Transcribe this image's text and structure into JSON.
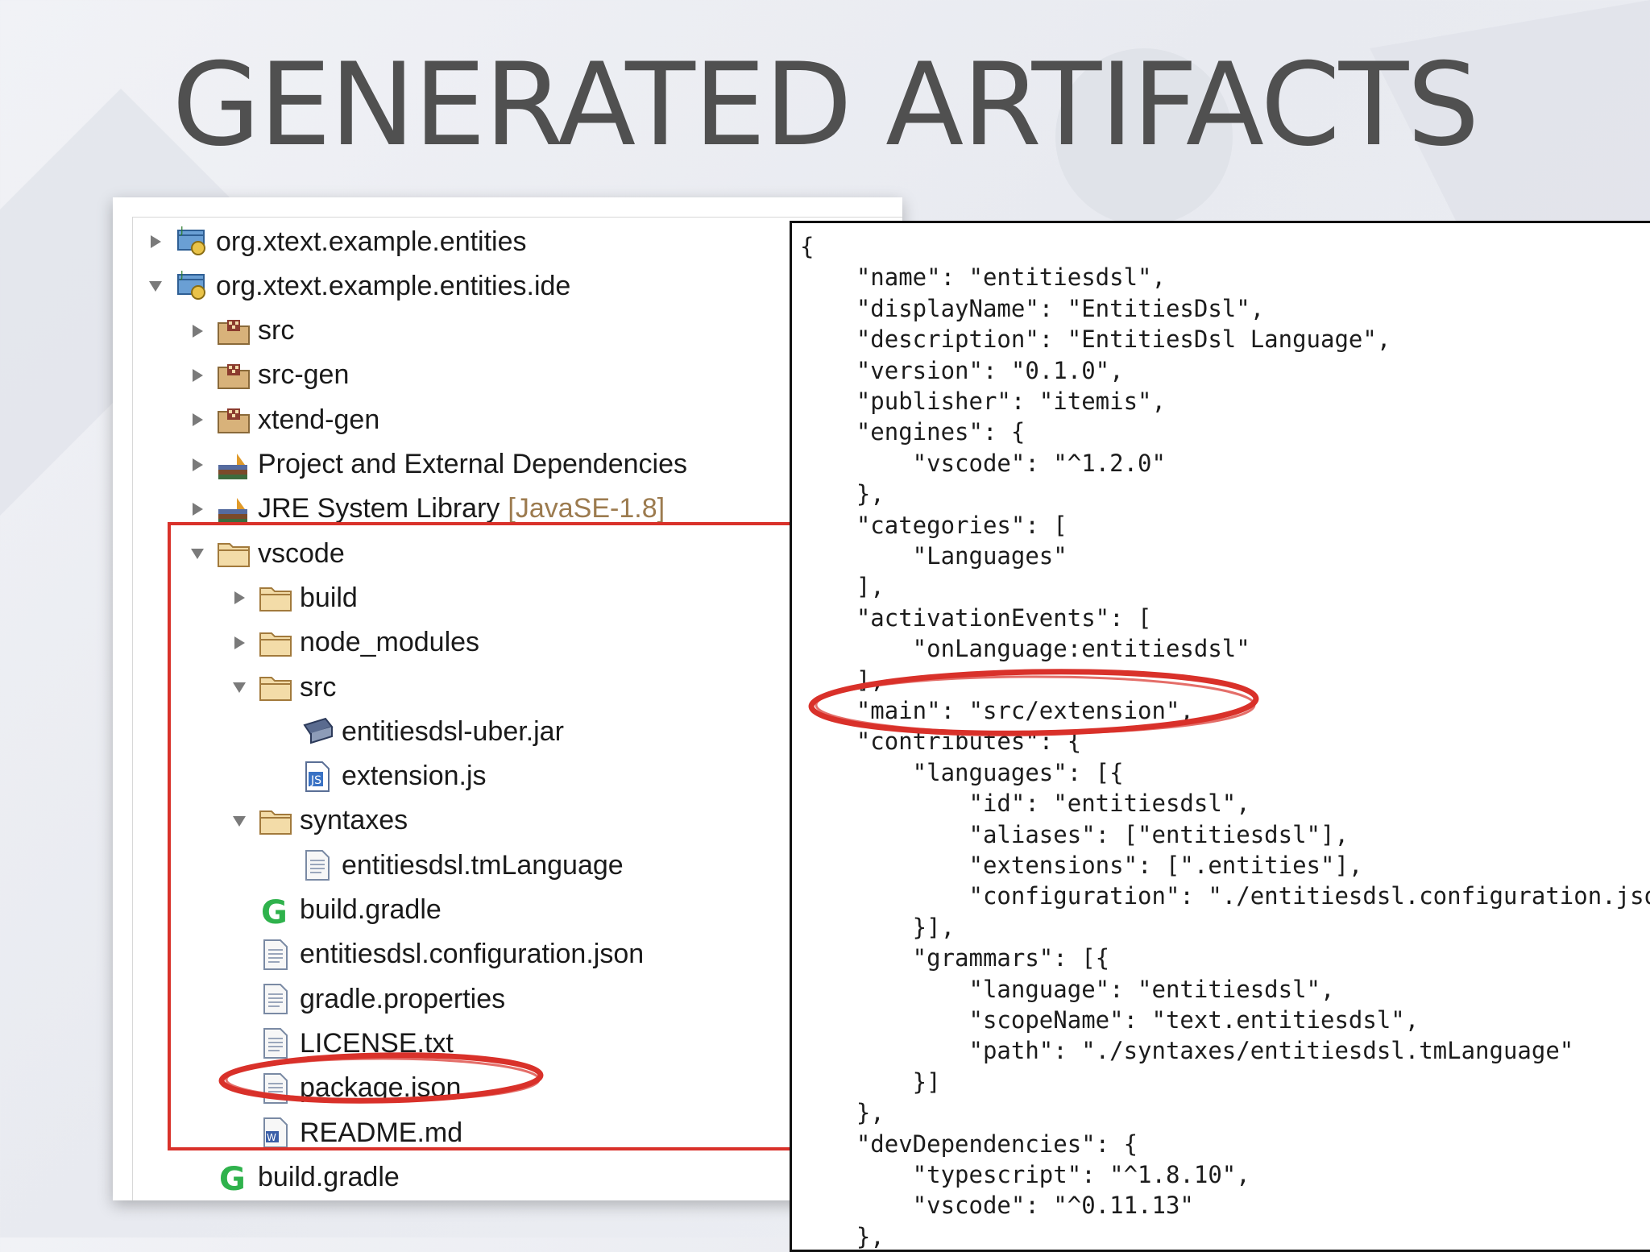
{
  "slide": {
    "title": "GENERATED ARTIFACTS"
  },
  "colors": {
    "annotation_red": "#d9312a",
    "title_gray": "#505050",
    "folder_tan": "#d8b27a"
  },
  "tree": {
    "items": [
      {
        "label": "org.xtext.example.entities",
        "icon": "project-icon",
        "depth": 0,
        "expanded": false
      },
      {
        "label": "org.xtext.example.entities.ide",
        "icon": "project-icon",
        "depth": 0,
        "expanded": true
      },
      {
        "label": "src",
        "icon": "source-folder-icon",
        "depth": 1,
        "expanded": false
      },
      {
        "label": "src-gen",
        "icon": "source-folder-icon",
        "depth": 1,
        "expanded": false
      },
      {
        "label": "xtend-gen",
        "icon": "source-folder-icon",
        "depth": 1,
        "expanded": false
      },
      {
        "label": "Project and External Dependencies",
        "icon": "library-icon",
        "depth": 1,
        "expanded": false
      },
      {
        "label": "JRE System Library",
        "suffix": "[JavaSE-1.8]",
        "icon": "library-icon",
        "depth": 1,
        "expanded": false
      },
      {
        "label": "vscode",
        "icon": "folder-icon",
        "depth": 1,
        "expanded": true
      },
      {
        "label": "build",
        "icon": "folder-icon",
        "depth": 2,
        "expanded": false
      },
      {
        "label": "node_modules",
        "icon": "folder-icon",
        "depth": 2,
        "expanded": false
      },
      {
        "label": "src",
        "icon": "folder-icon",
        "depth": 2,
        "expanded": true
      },
      {
        "label": "entitiesdsl-uber.jar",
        "icon": "jar-icon",
        "depth": 3
      },
      {
        "label": "extension.js",
        "icon": "js-file-icon",
        "depth": 3
      },
      {
        "label": "syntaxes",
        "icon": "folder-icon",
        "depth": 2,
        "expanded": true
      },
      {
        "label": "entitiesdsl.tmLanguage",
        "icon": "file-icon",
        "depth": 3
      },
      {
        "label": "build.gradle",
        "icon": "gradle-icon",
        "depth": 2
      },
      {
        "label": "entitiesdsl.configuration.json",
        "icon": "file-icon",
        "depth": 2
      },
      {
        "label": "gradle.properties",
        "icon": "file-icon",
        "depth": 2
      },
      {
        "label": "LICENSE.txt",
        "icon": "file-icon",
        "depth": 2
      },
      {
        "label": "package.json",
        "icon": "file-icon",
        "depth": 2
      },
      {
        "label": "README.md",
        "icon": "word-file-icon",
        "depth": 2
      },
      {
        "label": "build.gradle",
        "icon": "gradle-icon",
        "depth": 1
      }
    ]
  },
  "code": {
    "lines": [
      "{",
      "    \"name\": \"entitiesdsl\",",
      "    \"displayName\": \"EntitiesDsl\",",
      "    \"description\": \"EntitiesDsl Language\",",
      "    \"version\": \"0.1.0\",",
      "    \"publisher\": \"itemis\",",
      "    \"engines\": {",
      "        \"vscode\": \"^1.2.0\"",
      "    },",
      "    \"categories\": [",
      "        \"Languages\"",
      "    ],",
      "    \"activationEvents\": [",
      "        \"onLanguage:entitiesdsl\"",
      "    ],",
      "    \"main\": \"src/extension\",",
      "    \"contributes\": {",
      "        \"languages\": [{",
      "            \"id\": \"entitiesdsl\",",
      "            \"aliases\": [\"entitiesdsl\"],",
      "            \"extensions\": [\".entities\"],",
      "            \"configuration\": \"./entitiesdsl.configuration.json\"",
      "        }],",
      "        \"grammars\": [{",
      "            \"language\": \"entitiesdsl\",",
      "            \"scopeName\": \"text.entitiesdsl\",",
      "            \"path\": \"./syntaxes/entitiesdsl.tmLanguage\"",
      "        }]",
      "    },",
      "    \"devDependencies\": {",
      "        \"typescript\": \"^1.8.10\",",
      "        \"vscode\": \"^0.11.13\"",
      "    },"
    ]
  }
}
